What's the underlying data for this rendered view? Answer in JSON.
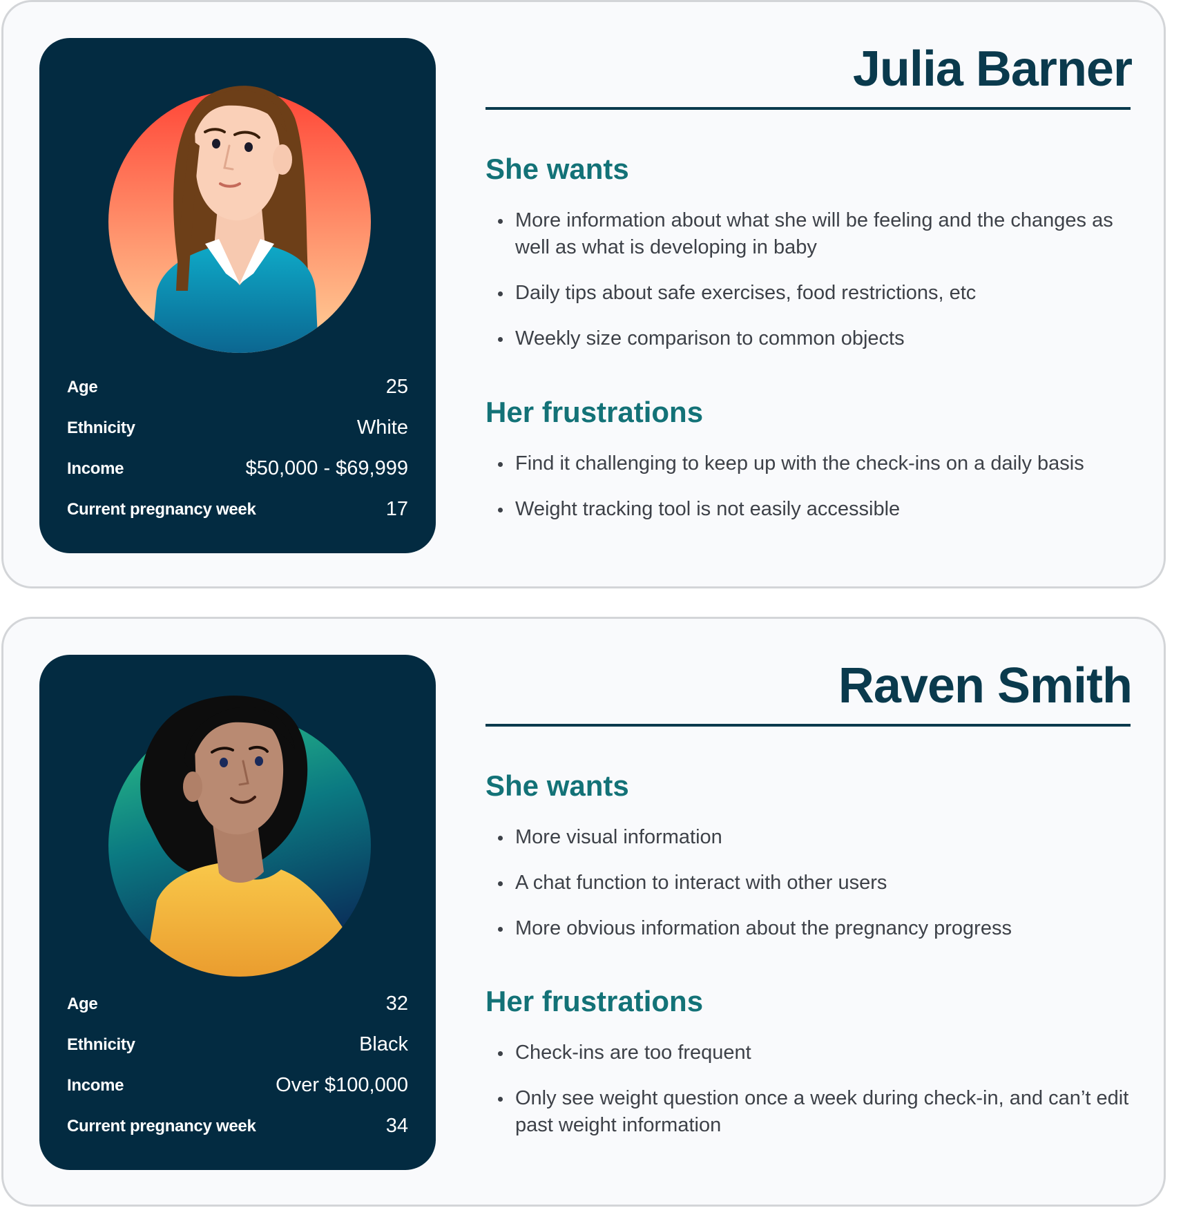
{
  "personas": [
    {
      "name": "Julia Barner",
      "avatar_icon": "woman-brown-hair-avatar",
      "colors": {
        "circle_top": "#ff4637",
        "circle_bottom": "#ffd39a",
        "shirt": "#0c8cab"
      },
      "stats": [
        {
          "label": "Age",
          "value": "25"
        },
        {
          "label": "Ethnicity",
          "value": "White"
        },
        {
          "label": "Income",
          "value": "$50,000 - $69,999"
        },
        {
          "label": "Current pregnancy week",
          "value": "17"
        }
      ],
      "wants_title": "She wants",
      "wants": [
        "More information about what she will be feeling and the changes as well as what is developing in baby",
        "Daily tips about safe exercises, food restrictions, etc",
        "Weekly size comparison to common objects"
      ],
      "frustrations_title": "Her frustrations",
      "frustrations": [
        "Find it challenging to keep up with the check-ins on a daily basis",
        "Weight tracking tool is not easily accessible"
      ]
    },
    {
      "name": "Raven Smith",
      "avatar_icon": "woman-curly-black-hair-avatar",
      "colors": {
        "circle_top": "#2fc887",
        "circle_bottom": "#0a2f5a",
        "shirt": "#f6b537"
      },
      "stats": [
        {
          "label": "Age",
          "value": "32"
        },
        {
          "label": "Ethnicity",
          "value": "Black"
        },
        {
          "label": "Income",
          "value": "Over $100,000"
        },
        {
          "label": "Current pregnancy week",
          "value": "34"
        }
      ],
      "wants_title": "She wants",
      "wants": [
        "More visual information",
        "A chat function to interact with other users",
        "More obvious information about the pregnancy progress"
      ],
      "frustrations_title": "Her frustrations",
      "frustrations": [
        "Check-ins are too frequent",
        "Only see weight question once a week during check-in, and can’t edit past weight information"
      ]
    }
  ],
  "colors": {
    "card_bg": "#032b41",
    "name_color": "#0a3a4d",
    "section_title_color": "#137277",
    "body_text": "#3d4148"
  }
}
